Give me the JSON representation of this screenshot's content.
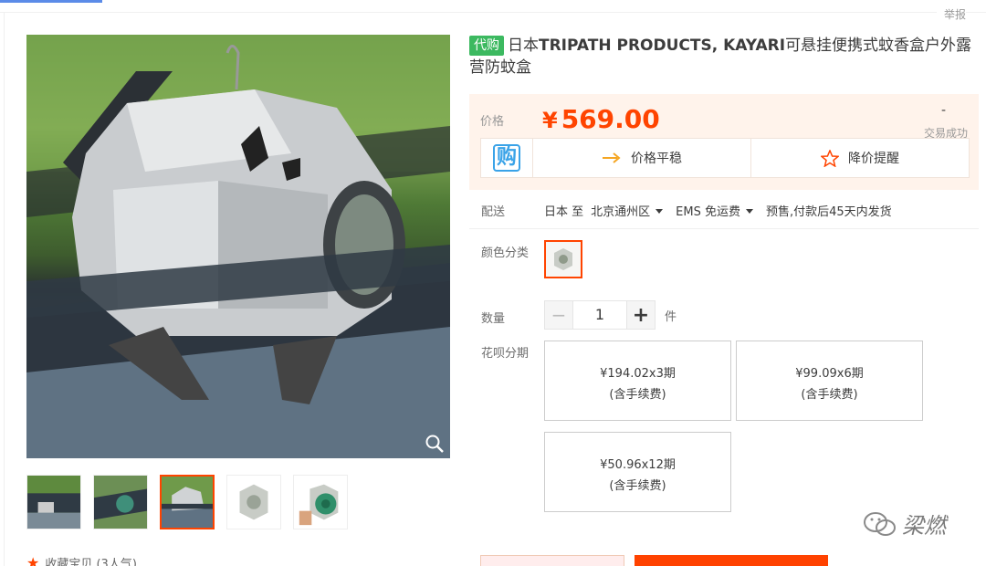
{
  "header": {
    "report_label": "举报"
  },
  "gallery": {
    "favorite_label": "收藏宝贝 (3人气)",
    "thumbnails": [
      "thumb-1",
      "thumb-2",
      "thumb-3",
      "thumb-4",
      "thumb-5"
    ],
    "active_thumbnail_index": 2
  },
  "product": {
    "badge": "代购",
    "title_prefix": "日本",
    "title_brand": "TRIPATH PRODUCTS, KAYARI",
    "title_rest": "可悬挂便携式蚊香盒户外露营防蚊盒"
  },
  "price": {
    "label": "价格",
    "currency": "¥",
    "value": "569.00",
    "deal_count": "-",
    "deal_label": "交易成功",
    "buy_logo": "购",
    "trend_label": "价格平稳",
    "alert_label": "降价提醒"
  },
  "shipping": {
    "label": "配送",
    "from": "日本 至",
    "to": "北京通州区",
    "method": "EMS 免运费",
    "note": "预售,付款后45天内发货"
  },
  "color": {
    "label": "颜色分类"
  },
  "quantity": {
    "label": "数量",
    "value": "1",
    "unit": "件",
    "minus": "−",
    "plus": "+"
  },
  "installment": {
    "label": "花呗分期",
    "plans": [
      {
        "amount": "¥194.02x3期",
        "fee": "(含手续费)"
      },
      {
        "amount": "¥99.09x6期",
        "fee": "(含手续费)"
      },
      {
        "amount": "¥50.96x12期",
        "fee": "(含手续费)"
      }
    ]
  },
  "watermark": {
    "text": "梁燃"
  },
  "colors": {
    "accent": "#ff4400",
    "badge_green": "#3cb960",
    "price_bg": "#fff3eb"
  }
}
